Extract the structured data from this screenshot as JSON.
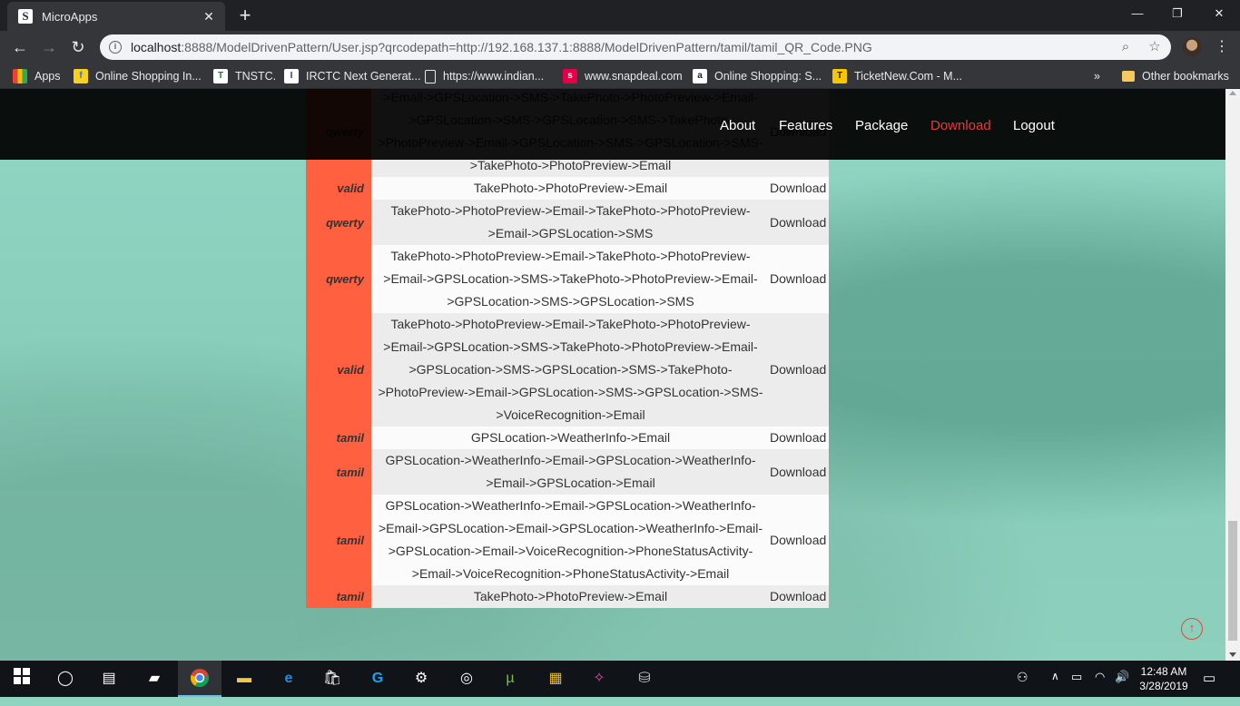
{
  "browser": {
    "tab_title": "MicroApps",
    "tab_favicon": "S",
    "url_host": "localhost",
    "url_rest": ":8888/ModelDrivenPattern/User.jsp?qrcodepath=http://192.168.137.1:8888/ModelDrivenPattern/tamil/tamil_QR_Code.PNG",
    "bookmarks": [
      {
        "label": "Apps",
        "icon": "apps-grid-icon"
      },
      {
        "label": "Online Shopping In...",
        "icon": "flipkart-icon"
      },
      {
        "label": "TNSTC.",
        "icon": "tnstc-icon"
      },
      {
        "label": "IRCTC Next Generat...",
        "icon": "irctc-icon"
      },
      {
        "label": "https://www.indian...",
        "icon": "page-icon"
      },
      {
        "label": "www.snapdeal.com",
        "icon": "snapdeal-icon"
      },
      {
        "label": "Online Shopping: S...",
        "icon": "amazon-icon"
      },
      {
        "label": "TicketNew.Com - M...",
        "icon": "ticketnew-icon"
      }
    ],
    "bookmarks_overflow": "»",
    "other_bookmarks": "Other bookmarks"
  },
  "nav": {
    "about": "About",
    "features": "Features",
    "package": "Package",
    "download": "Download",
    "logout": "Logout",
    "active_color": "#e63a36"
  },
  "table": {
    "partial_top": {
      "name": "qwerty",
      "lines": [
        ">Email->GPSLocation->SMS->TakePhoto->PhotoPreview->Email-",
        ">GPSLocation->SMS->GPSLocation->SMS->TakePhoto-",
        ">PhotoPreview->Email->GPSLocation->SMS->GPSLocation->SMS-",
        ">TakePhoto->PhotoPreview->Email"
      ],
      "action": "Download"
    },
    "rows": [
      {
        "name": "valid",
        "lines": [
          "TakePhoto->PhotoPreview->Email"
        ],
        "action": "Download"
      },
      {
        "name": "qwerty",
        "lines": [
          "TakePhoto->PhotoPreview->Email->TakePhoto->PhotoPreview-",
          ">Email->GPSLocation->SMS"
        ],
        "action": "Download"
      },
      {
        "name": "qwerty",
        "lines": [
          "TakePhoto->PhotoPreview->Email->TakePhoto->PhotoPreview-",
          ">Email->GPSLocation->SMS->TakePhoto->PhotoPreview->Email-",
          ">GPSLocation->SMS->GPSLocation->SMS"
        ],
        "action": "Download"
      },
      {
        "name": "valid",
        "lines": [
          "TakePhoto->PhotoPreview->Email->TakePhoto->PhotoPreview-",
          ">Email->GPSLocation->SMS->TakePhoto->PhotoPreview->Email-",
          ">GPSLocation->SMS->GPSLocation->SMS->TakePhoto-",
          ">PhotoPreview->Email->GPSLocation->SMS->GPSLocation->SMS-",
          ">VoiceRecognition->Email"
        ],
        "action": "Download"
      },
      {
        "name": "tamil",
        "lines": [
          "GPSLocation->WeatherInfo->Email"
        ],
        "action": "Download"
      },
      {
        "name": "tamil",
        "lines": [
          "GPSLocation->WeatherInfo->Email->GPSLocation->WeatherInfo-",
          ">Email->GPSLocation->Email"
        ],
        "action": "Download"
      },
      {
        "name": "tamil",
        "lines": [
          "GPSLocation->WeatherInfo->Email->GPSLocation->WeatherInfo-",
          ">Email->GPSLocation->Email->GPSLocation->WeatherInfo->Email-",
          ">GPSLocation->Email->VoiceRecognition->PhoneStatusActivity-",
          ">Email->VoiceRecognition->PhoneStatusActivity->Email"
        ],
        "action": "Download"
      },
      {
        "name": "tamil",
        "lines": [
          "TakePhoto->PhotoPreview->Email"
        ],
        "action": "Download"
      }
    ],
    "name_cell_color": "#fe6040"
  },
  "scroll_to_top_icon": "arrow-up-circle-icon",
  "taskbar": {
    "time": "12:48 AM",
    "date": "3/28/2019"
  }
}
